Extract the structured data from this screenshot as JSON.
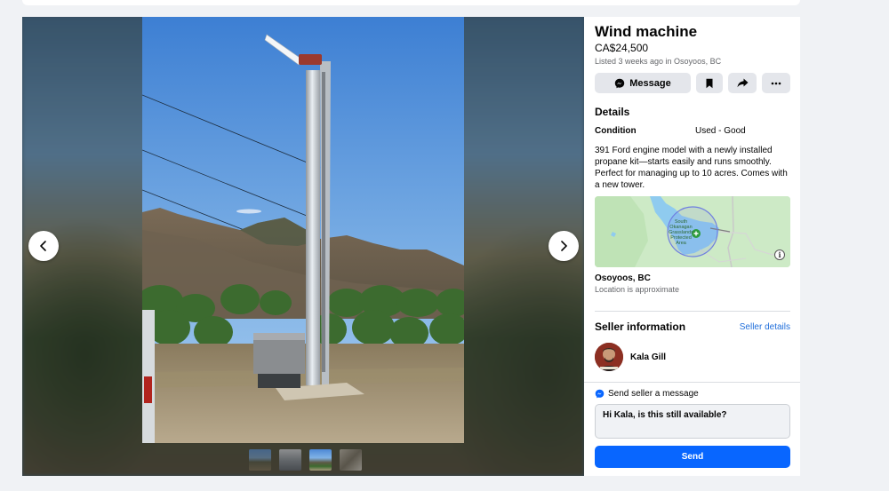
{
  "listing": {
    "title": "Wind machine",
    "price": "CA$24,500",
    "listed": "Listed 3 weeks ago in Osoyoos, BC"
  },
  "actions": {
    "message_label": "Message",
    "save_icon": "bookmark-icon",
    "share_icon": "share-icon",
    "more_icon": "more-icon"
  },
  "details": {
    "heading": "Details",
    "condition_label": "Condition",
    "condition_value": "Used - Good",
    "description": "391 Ford engine model with a newly installed propane kit—starts easily and runs smoothly. Perfect for managing up to 10 acres. Comes with a new tower."
  },
  "map": {
    "label_line1": "South",
    "label_line2": "Okanagan",
    "label_line3": "Grasslands",
    "label_line4": "Protected",
    "label_line5": "Area",
    "info_glyph": "i"
  },
  "location": {
    "name": "Osoyoos, BC",
    "note": "Location is approximate"
  },
  "seller": {
    "heading": "Seller information",
    "details_link": "Seller details",
    "name": "Kala Gill"
  },
  "message": {
    "heading": "Send seller a message",
    "default_text": "Hi Kala, is this still available?",
    "send_label": "Send"
  },
  "viewer": {
    "prev_icon": "chevron-left-icon",
    "next_icon": "chevron-right-icon",
    "thumbnail_count": 4,
    "active_thumbnail": 3
  },
  "colors": {
    "accent": "#0866ff",
    "link": "#216fdb",
    "button_bg": "#e4e6eb",
    "muted_text": "#65676b"
  }
}
